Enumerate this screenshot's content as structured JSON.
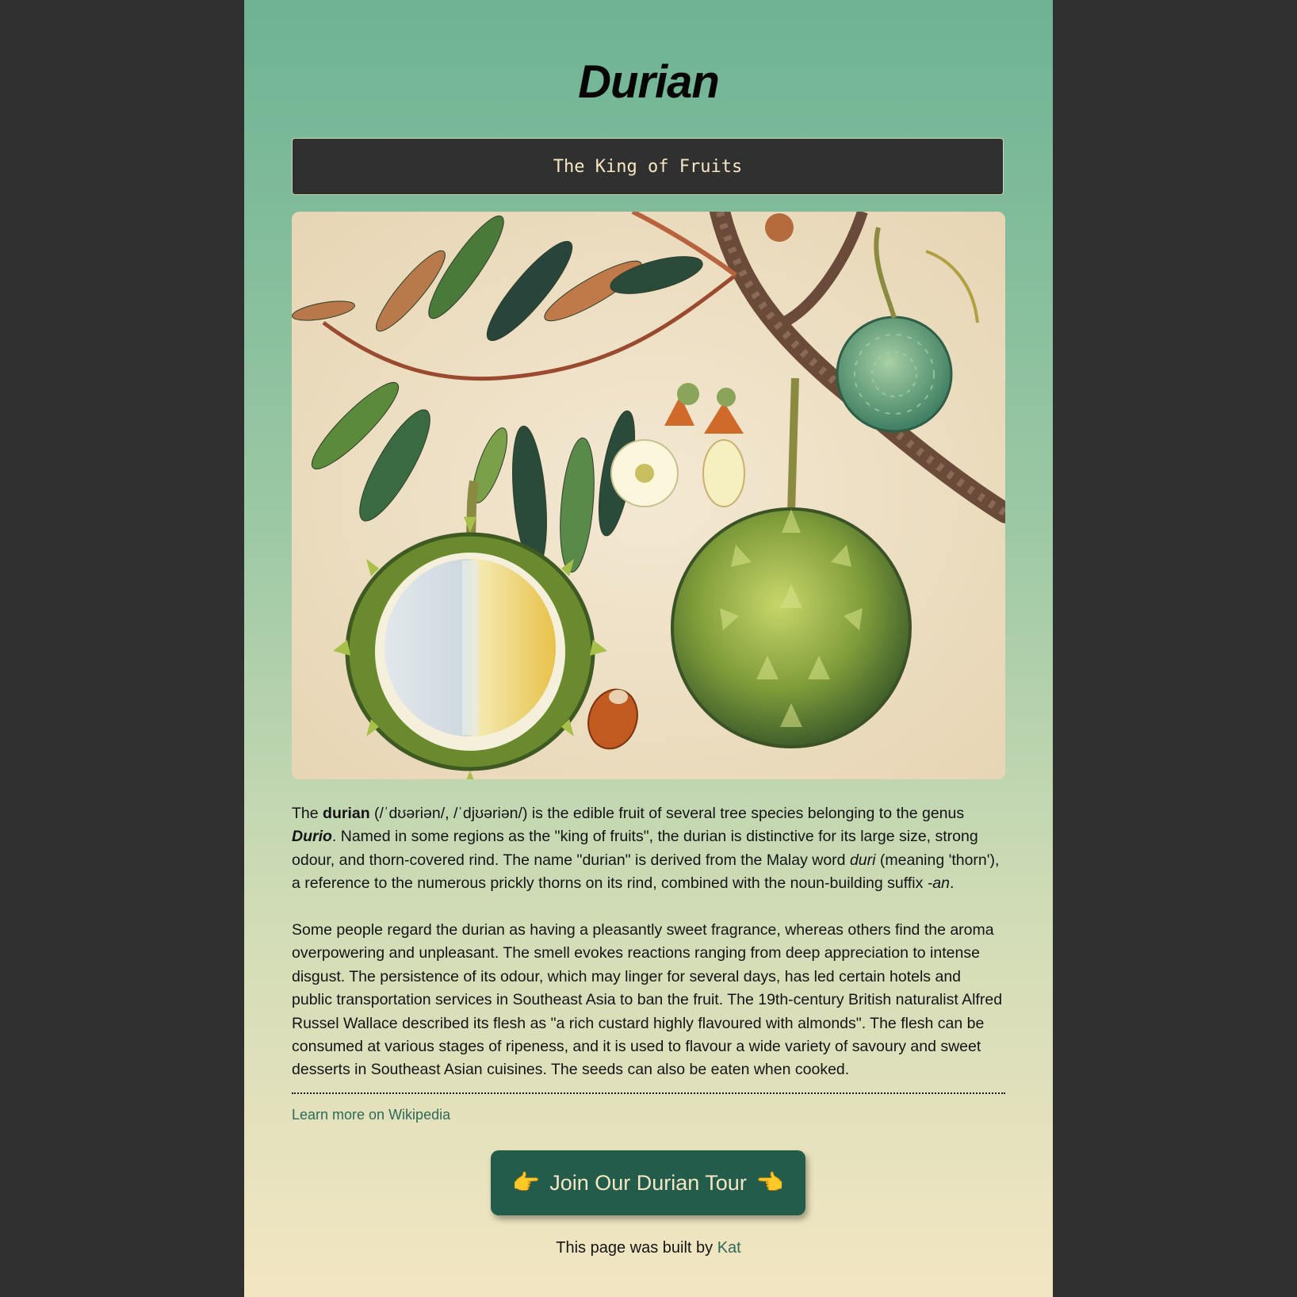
{
  "page": {
    "title": "Durian",
    "tagline": "The King of Fruits"
  },
  "paragraph1": {
    "t1": "The ",
    "bold": "durian",
    "t2": " (/ˈdʊəriən/, /ˈdjʊəriən/) is the edible fruit of several tree species belonging to the genus ",
    "genus": "Durio",
    "t3": ". Named in some regions as the \"king of fruits\", the durian is distinctive for its large size, strong odour, and thorn-covered rind. The name \"durian\" is derived from the Malay word ",
    "duri": "duri",
    "t4": " (meaning 'thorn'), a reference to the numerous prickly thorns on its rind, combined with the noun-building suffix ",
    "suffix": "-an",
    "t5": "."
  },
  "paragraph2": "Some people regard the durian as having a pleasantly sweet fragrance, whereas others find the aroma overpowering and unpleasant. The smell evokes reactions ranging from deep appreciation to intense disgust. The persistence of its odour, which may linger for several days, has led certain hotels and public transportation services in Southeast Asia to ban the fruit. The 19th-century British naturalist Alfred Russel Wallace described its flesh as \"a rich custard highly flavoured with almonds\". The flesh can be consumed at various stages of ripeness, and it is used to flavour a wide variety of savoury and sweet desserts in Southeast Asian cuisines. The seeds can also be eaten when cooked.",
  "links": {
    "wikipedia": "Learn more on Wikipedia"
  },
  "cta": {
    "left_icon": "👉",
    "label": "Join Our Durian Tour",
    "right_icon": "👈"
  },
  "footer": {
    "text": "This page was built by ",
    "author": "Kat"
  },
  "colors": {
    "outer_background": "#303030",
    "gradient_top": "#6db394",
    "gradient_bottom": "#f3e6c2",
    "tagline_box": "#303030",
    "tagline_text": "#f6e7c4",
    "button": "#245c4c",
    "link": "#2e6a57"
  }
}
